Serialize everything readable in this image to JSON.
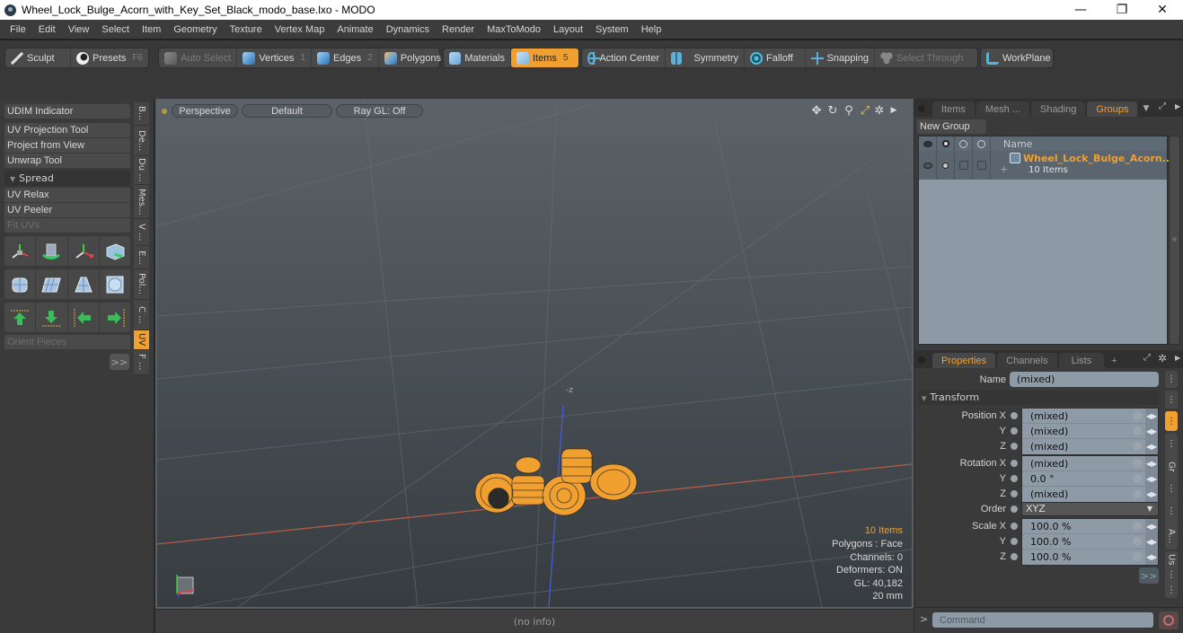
{
  "window": {
    "title": "Wheel_Lock_Bulge_Acorn_with_Key_Set_Black_modo_base.lxo - MODO",
    "minimize": "—",
    "maximize": "❐",
    "close": "✕"
  },
  "menubar": {
    "items": [
      "File",
      "Edit",
      "View",
      "Select",
      "Item",
      "Geometry",
      "Texture",
      "Vertex Map",
      "Animate",
      "Dynamics",
      "Render",
      "MaxToModo",
      "Layout",
      "System",
      "Help"
    ]
  },
  "toolbar": {
    "sculpt": "Sculpt",
    "presets": "Presets",
    "presets_key": "F6",
    "auto_select": "Auto Select",
    "vertices": "Vertices",
    "vertices_key": "1",
    "edges": "Edges",
    "edges_key": "2",
    "polygons": "Polygons",
    "materials": "Materials",
    "items": "Items",
    "items_key": "5",
    "action_center": "Action Center",
    "symmetry": "Symmetry",
    "falloff": "Falloff",
    "snapping": "Snapping",
    "select_through": "Select Through",
    "workplane": "WorkPlane",
    "accent_color": "#f0a030"
  },
  "left_panel": {
    "udim_indicator": "UDIM Indicator",
    "uv_projection_tool": "UV Projection Tool",
    "project_from_view": "Project from View",
    "unwrap_tool": "Unwrap Tool",
    "spread": "Spread",
    "uv_relax": "UV Relax",
    "uv_peeler": "UV Peeler",
    "fit_uvs": "Fit UVs",
    "orient_pieces": "Orient Pieces",
    "more": ">>",
    "vertical_tabs": [
      "B...",
      "De...",
      "Du ...",
      "Mes...",
      "V ...",
      "E...",
      "Pol...",
      "C ...",
      "UV",
      "F ..."
    ],
    "active_tab": "UV"
  },
  "viewport": {
    "view_mode": "Perspective",
    "shading": "Default",
    "raygl": "Ray GL: Off",
    "center_label": "-z",
    "info": {
      "items": "10 Items",
      "polygons": "Polygons : Face",
      "channels": "Channels: 0",
      "deformers": "Deformers: ON",
      "gl": "GL: 40,182",
      "scale": "20 mm"
    }
  },
  "status_bar": {
    "text": "(no info)"
  },
  "groups_panel": {
    "tabs": [
      "Items",
      "Mesh ...",
      "Shading",
      "Groups"
    ],
    "active_tab": "Groups",
    "new_group": "New Group",
    "column_name": "Name",
    "rows": [
      {
        "name": "Wheel_Lock_Bulge_Acorn...",
        "subtitle": "10 Items"
      }
    ]
  },
  "properties_panel": {
    "tabs": [
      "Properties",
      "Channels",
      "Lists"
    ],
    "active_tab": "Properties",
    "name_label": "Name",
    "name_value": "(mixed)",
    "transform_section": "Transform",
    "position": {
      "label": "Position X",
      "x": "(mixed)",
      "y": "(mixed)",
      "z": "(mixed)"
    },
    "rotation": {
      "label": "Rotation X",
      "x": "(mixed)",
      "y": "0.0 °",
      "z": "(mixed)"
    },
    "order_label": "Order",
    "order_value": "XYZ",
    "scale": {
      "label": "Scale X",
      "x": "100.0 %",
      "y": "100.0 %",
      "z": "100.0 %"
    },
    "axis_y": "Y",
    "axis_z": "Z",
    "more": ">>",
    "side_tabs": [
      "Gr",
      "A...",
      "Us"
    ]
  },
  "command_bar": {
    "prompt": ">",
    "placeholder": "Command"
  }
}
